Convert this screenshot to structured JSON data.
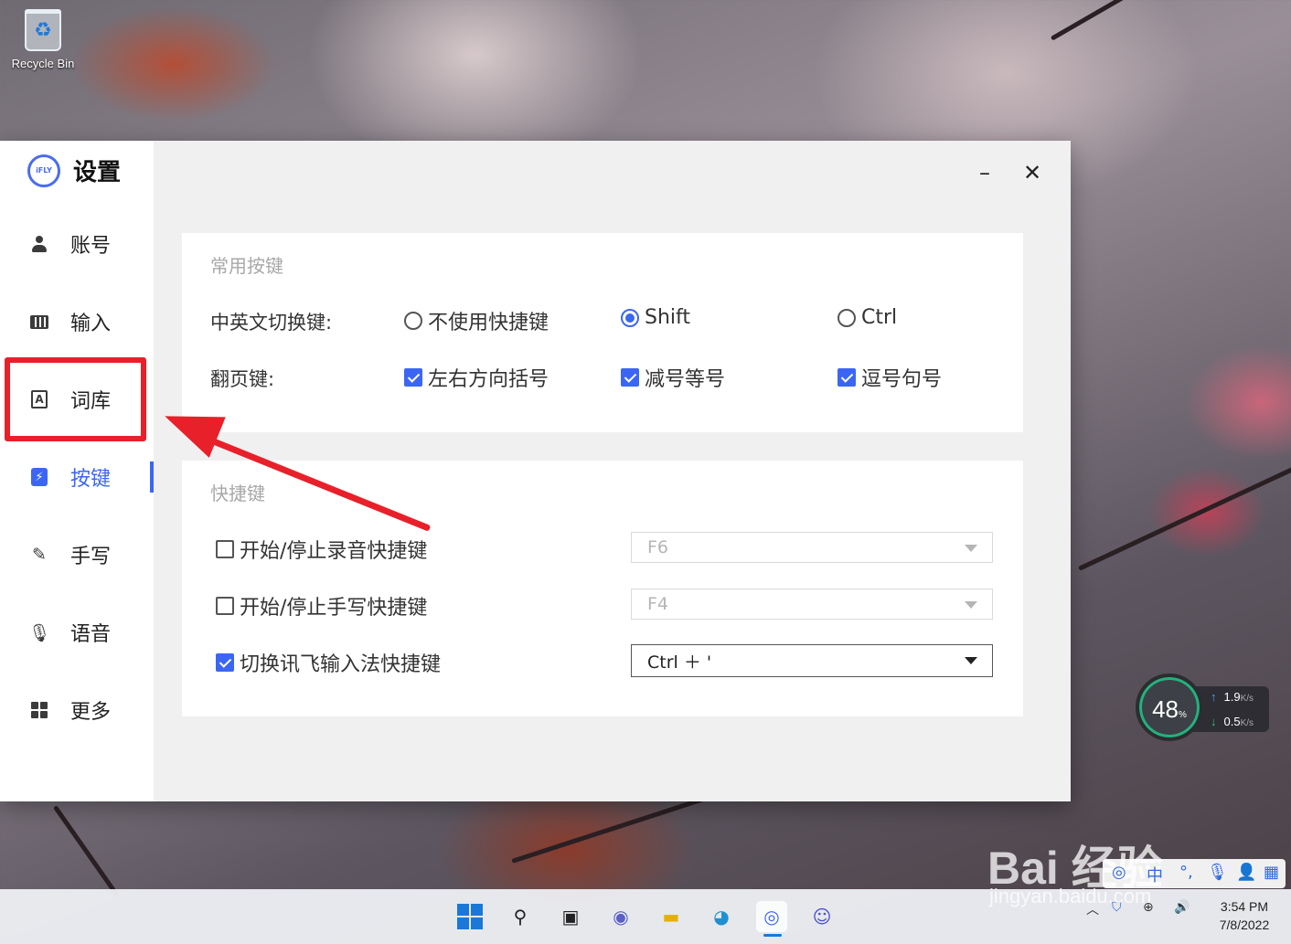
{
  "desktop": {
    "recycle_bin_label": "Recycle Bin"
  },
  "window": {
    "logo_text": "iFLY",
    "title": "设置",
    "minimize_label": "–",
    "close_label": "✕"
  },
  "sidebar": {
    "items": [
      {
        "label": "账号",
        "icon": "person-icon"
      },
      {
        "label": "输入",
        "icon": "keyboard-icon"
      },
      {
        "label": "词库",
        "icon": "dictionary-icon"
      },
      {
        "label": "按键",
        "icon": "key-icon",
        "active": true
      },
      {
        "label": "手写",
        "icon": "pen-icon"
      },
      {
        "label": "语音",
        "icon": "microphone-icon"
      },
      {
        "label": "更多",
        "icon": "grid-icon"
      }
    ]
  },
  "common_keys": {
    "title": "常用按键",
    "switch_label": "中英文切换键:",
    "switch_options": [
      {
        "label": "不使用快捷键",
        "selected": false
      },
      {
        "label": "Shift",
        "selected": true
      },
      {
        "label": "Ctrl",
        "selected": false
      }
    ],
    "page_label": "翻页键:",
    "page_options": [
      {
        "label": "左右方向括号",
        "checked": true
      },
      {
        "label": "减号等号",
        "checked": true
      },
      {
        "label": "逗号句号",
        "checked": true
      }
    ]
  },
  "shortcuts": {
    "title": "快捷键",
    "rows": [
      {
        "label": "开始/停止录音快捷键",
        "checked": false,
        "value": "F6"
      },
      {
        "label": "开始/停止手写快捷键",
        "checked": false,
        "value": "F4"
      },
      {
        "label": "切换讯飞输入法快捷键",
        "checked": true,
        "value": "Ctrl ＋ '"
      }
    ]
  },
  "network_widget": {
    "percent": "48",
    "percent_unit": "%",
    "upload": "1.9",
    "download": "0.5",
    "unit": "K/s"
  },
  "taskbar": {
    "time": "3:54 PM",
    "date": "7/8/2022",
    "ime_indicator": "中"
  },
  "watermark": {
    "brand": "Bai 经验",
    "url": "jingyan.baidu.com"
  },
  "colors": {
    "accent": "#3b66f5",
    "annotation_red": "#e8202a"
  }
}
